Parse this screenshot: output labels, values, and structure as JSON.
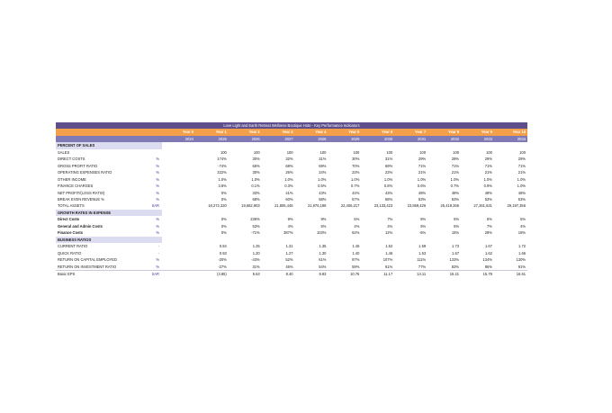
{
  "title": "Love Light and Earth Retreat Wellness Boutique Hote - Key Performance Indicators",
  "columns": [
    "Year 0",
    "Year 1",
    "Year 2",
    "Year 3",
    "Year 4",
    "Year 5",
    "Year 6",
    "Year 7",
    "Year 8",
    "Year 9",
    "Year 10"
  ],
  "dates": [
    "2024",
    "2025",
    "2026",
    "2027",
    "2028",
    "2029",
    "2030",
    "2031",
    "2032",
    "2033",
    "2034"
  ],
  "sections": [
    {
      "heading": "PERCENT OF SALES",
      "rows": [
        {
          "label": "SALES",
          "unit": "",
          "values": [
            "",
            "100",
            "100",
            "100",
            "100",
            "100",
            "100",
            "100",
            "100",
            "100",
            "100"
          ]
        },
        {
          "label": "DIRECT COSTS",
          "unit": "%",
          "values": [
            "",
            "174%",
            "30%",
            "32%",
            "31%",
            "30%",
            "31%",
            "29%",
            "29%",
            "29%",
            "29%"
          ]
        },
        {
          "label": "GROSS PROFIT RATIO",
          "unit": "%",
          "values": [
            "",
            "-74%",
            "65%",
            "68%",
            "69%",
            "70%",
            "69%",
            "71%",
            "71%",
            "71%",
            "71%"
          ]
        },
        {
          "label": "OPERATING EXPENSES RATIO",
          "unit": "%",
          "values": [
            "",
            "322%",
            "30%",
            "26%",
            "24%",
            "23%",
            "23%",
            "21%",
            "21%",
            "21%",
            "21%"
          ]
        },
        {
          "label": "OTHER INCOME",
          "unit": "%",
          "values": [
            "",
            "1.0%",
            "1.0%",
            "1.0%",
            "1.0%",
            "1.0%",
            "1.0%",
            "1.0%",
            "1.0%",
            "1.0%",
            "1.0%"
          ]
        },
        {
          "label": "FINANCE CHARGES",
          "unit": "%",
          "values": [
            "",
            "3.8%",
            "0.1%",
            "0.3%",
            "0.5%",
            "0.7%",
            "0.8%",
            "0.6%",
            "0.7%",
            "0.9%",
            "1.0%"
          ]
        },
        {
          "label": "NET PROFIT/(LOSS RATIO)",
          "unit": "%",
          "values": [
            "",
            "0%",
            "33%",
            "41%",
            "43%",
            "44%",
            "43%",
            "48%",
            "48%",
            "48%",
            "48%"
          ]
        },
        {
          "label": "BREAK EVEN REVENUE %",
          "unit": "%",
          "values": [
            "",
            "0%",
            "68%",
            "60%",
            "58%",
            "57%",
            "58%",
            "53%",
            "53%",
            "53%",
            "53%"
          ]
        },
        {
          "label": "TOTAL ASSETS",
          "unit": "SAR",
          "values": [
            "",
            "18,272,320",
            "19,682,903",
            "21,805,445",
            "21,976,198",
            "22,406,217",
            "23,133,423",
            "23,869,426",
            "25,419,366",
            "27,261,631",
            "29,197,356"
          ]
        }
      ]
    },
    {
      "heading": "GROWTH RATES IN EXPENSE",
      "bold_labels": true,
      "rows": [
        {
          "label": "Direct Costs",
          "unit": "%",
          "values": [
            "",
            "0%",
            "236%",
            "9%",
            "9%",
            "5%",
            "7%",
            "8%",
            "5%",
            "5%",
            "5%"
          ]
        },
        {
          "label": "General and Admin Costs",
          "unit": "%",
          "values": [
            "",
            "0%",
            "53%",
            "4%",
            "5%",
            "4%",
            "4%",
            "5%",
            "5%",
            "7%",
            "4%"
          ]
        },
        {
          "label": "Finance Costs",
          "unit": "%",
          "values": [
            "",
            "0%",
            "-71%",
            "387%",
            "103%",
            "62%",
            "12%",
            "-5%",
            "15%",
            "28%",
            "18%"
          ]
        }
      ]
    },
    {
      "heading": "BUSINESS RATIOS",
      "rows": [
        {
          "label": "CURRENT RATIO",
          "unit": "-",
          "values": [
            "",
            "0.94",
            "1.25",
            "1.31",
            "1.35",
            "1.45",
            "1.52",
            "1.59",
            "1.73",
            "1.67",
            "1.72"
          ]
        },
        {
          "label": "QUICK RATIO",
          "unit": "-",
          "values": [
            "",
            "0.93",
            "1.20",
            "1.27",
            "1.30",
            "1.40",
            "1.46",
            "1.53",
            "1.67",
            "1.62",
            "1.66"
          ]
        },
        {
          "label": "RETURN ON CAPITAL EMPLOYED",
          "unit": "%",
          "values": [
            "",
            "-20%",
            "-43%",
            "52%",
            "61%",
            "87%",
            "107%",
            "111%",
            "133%",
            "134%",
            "130%"
          ]
        },
        {
          "label": "RETURN ON INVESTMENT RATIO",
          "unit": "%",
          "values": [
            "",
            "-27%",
            "31%",
            "46%",
            "54%",
            "59%",
            "61%",
            "77%",
            "83%",
            "86%",
            "91%"
          ]
        }
      ]
    }
  ],
  "eps": {
    "label": "Basic EPS",
    "unit": "SAR",
    "values": [
      "",
      "(4.85)",
      "5.63",
      "8.40",
      "9.83",
      "10.76",
      "11.17",
      "14.11",
      "15.21",
      "15.79",
      "16.61"
    ]
  }
}
